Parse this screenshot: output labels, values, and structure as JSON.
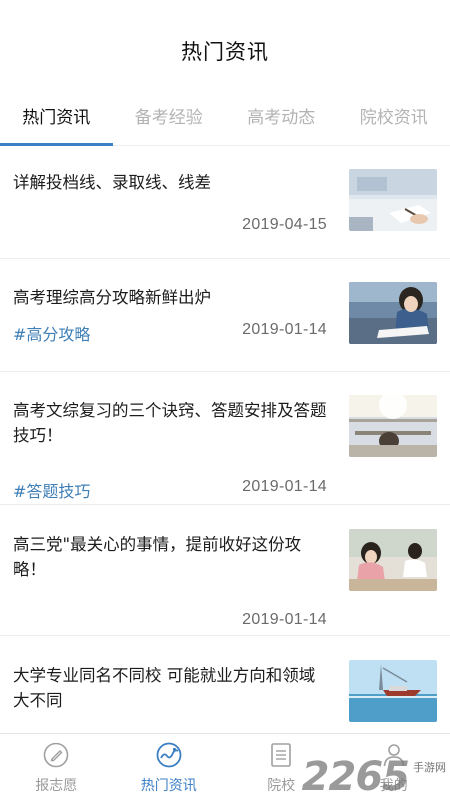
{
  "header": {
    "title": "热门资讯"
  },
  "tabs": [
    {
      "label": "热门资讯",
      "active": true
    },
    {
      "label": "备考经验",
      "active": false
    },
    {
      "label": "高考动态",
      "active": false
    },
    {
      "label": "院校资讯",
      "active": false
    }
  ],
  "news": [
    {
      "title": "详解投档线、录取线、线差",
      "tag": "",
      "date": "2019-04-15",
      "thumb": "student-writing-photo"
    },
    {
      "title": "高考理综高分攻略新鲜出炉",
      "tag": "#高分攻略",
      "date": "2019-01-14",
      "thumb": "girl-studying-photo"
    },
    {
      "title": "高考文综复习的三个诀窍、答题安排及答题技巧！",
      "tag": "#答题技巧",
      "date": "2019-01-14",
      "thumb": "classroom-photo"
    },
    {
      "title": "高三党\"最关心的事情，提前收好这份攻略！",
      "tag": "",
      "date": "2019-01-14",
      "thumb": "students-desk-photo"
    },
    {
      "title": "大学专业同名不同校 可能就业方向和领域大不同",
      "tag": "",
      "date": "2019-01-14",
      "thumb": "harbor-ship-photo"
    }
  ],
  "bottom_nav": [
    {
      "label": "报志愿",
      "icon": "pen-circle-icon",
      "active": false
    },
    {
      "label": "热门资讯",
      "icon": "news-wave-icon",
      "active": true
    },
    {
      "label": "院校",
      "icon": "document-list-icon",
      "active": false
    },
    {
      "label": "我的",
      "icon": "user-icon",
      "active": false
    }
  ],
  "watermark": {
    "number": "2265",
    "text": "手游网"
  },
  "colors": {
    "accent": "#3b7fc4",
    "tag": "#3f7fb6",
    "inactive": "#b3b3b3"
  }
}
